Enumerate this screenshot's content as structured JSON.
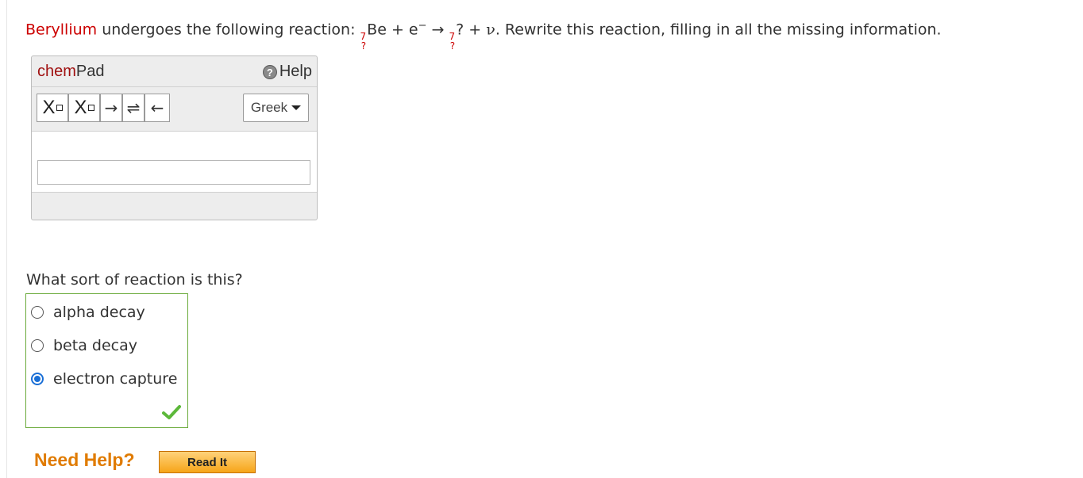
{
  "question": {
    "element": "Beryllium",
    "before": " undergoes the following reaction: ",
    "reactant_mass": "7",
    "reactant_atomic": "?",
    "reactant_symbol": "Be",
    "plus1": " + e",
    "electron_charge": "−",
    "arrow": " → ",
    "product_mass": "7",
    "product_atomic": "?",
    "product_symbol": "?",
    "plus2": " + ",
    "neutrino": "ν",
    "after": ". Rewrite this reaction, filling in all the missing information."
  },
  "chempad": {
    "title_chem": "chem",
    "title_pad": "Pad",
    "help_icon": "?",
    "help_label": "Help",
    "toolbar": {
      "subscript_label": "X",
      "superscript_label": "X",
      "arrow_right": "→",
      "arrow_equilibrium": "⇌",
      "arrow_left": "←",
      "greek_label": "Greek"
    },
    "input_value": ""
  },
  "reaction_type": {
    "question": "What sort of reaction is this?",
    "options": [
      {
        "label": "alpha decay",
        "selected": false
      },
      {
        "label": "beta decay",
        "selected": false
      },
      {
        "label": "electron capture",
        "selected": true
      }
    ],
    "result_icon": "check-mark",
    "correct_color": "#5cb83a"
  },
  "help": {
    "need_help": "Need Help?",
    "read_it": "Read It"
  },
  "colors": {
    "element_red": "#cc0000",
    "chem_red": "#a01010",
    "need_help_orange": "#e07b00",
    "radio_blue": "#1a6fd6"
  }
}
